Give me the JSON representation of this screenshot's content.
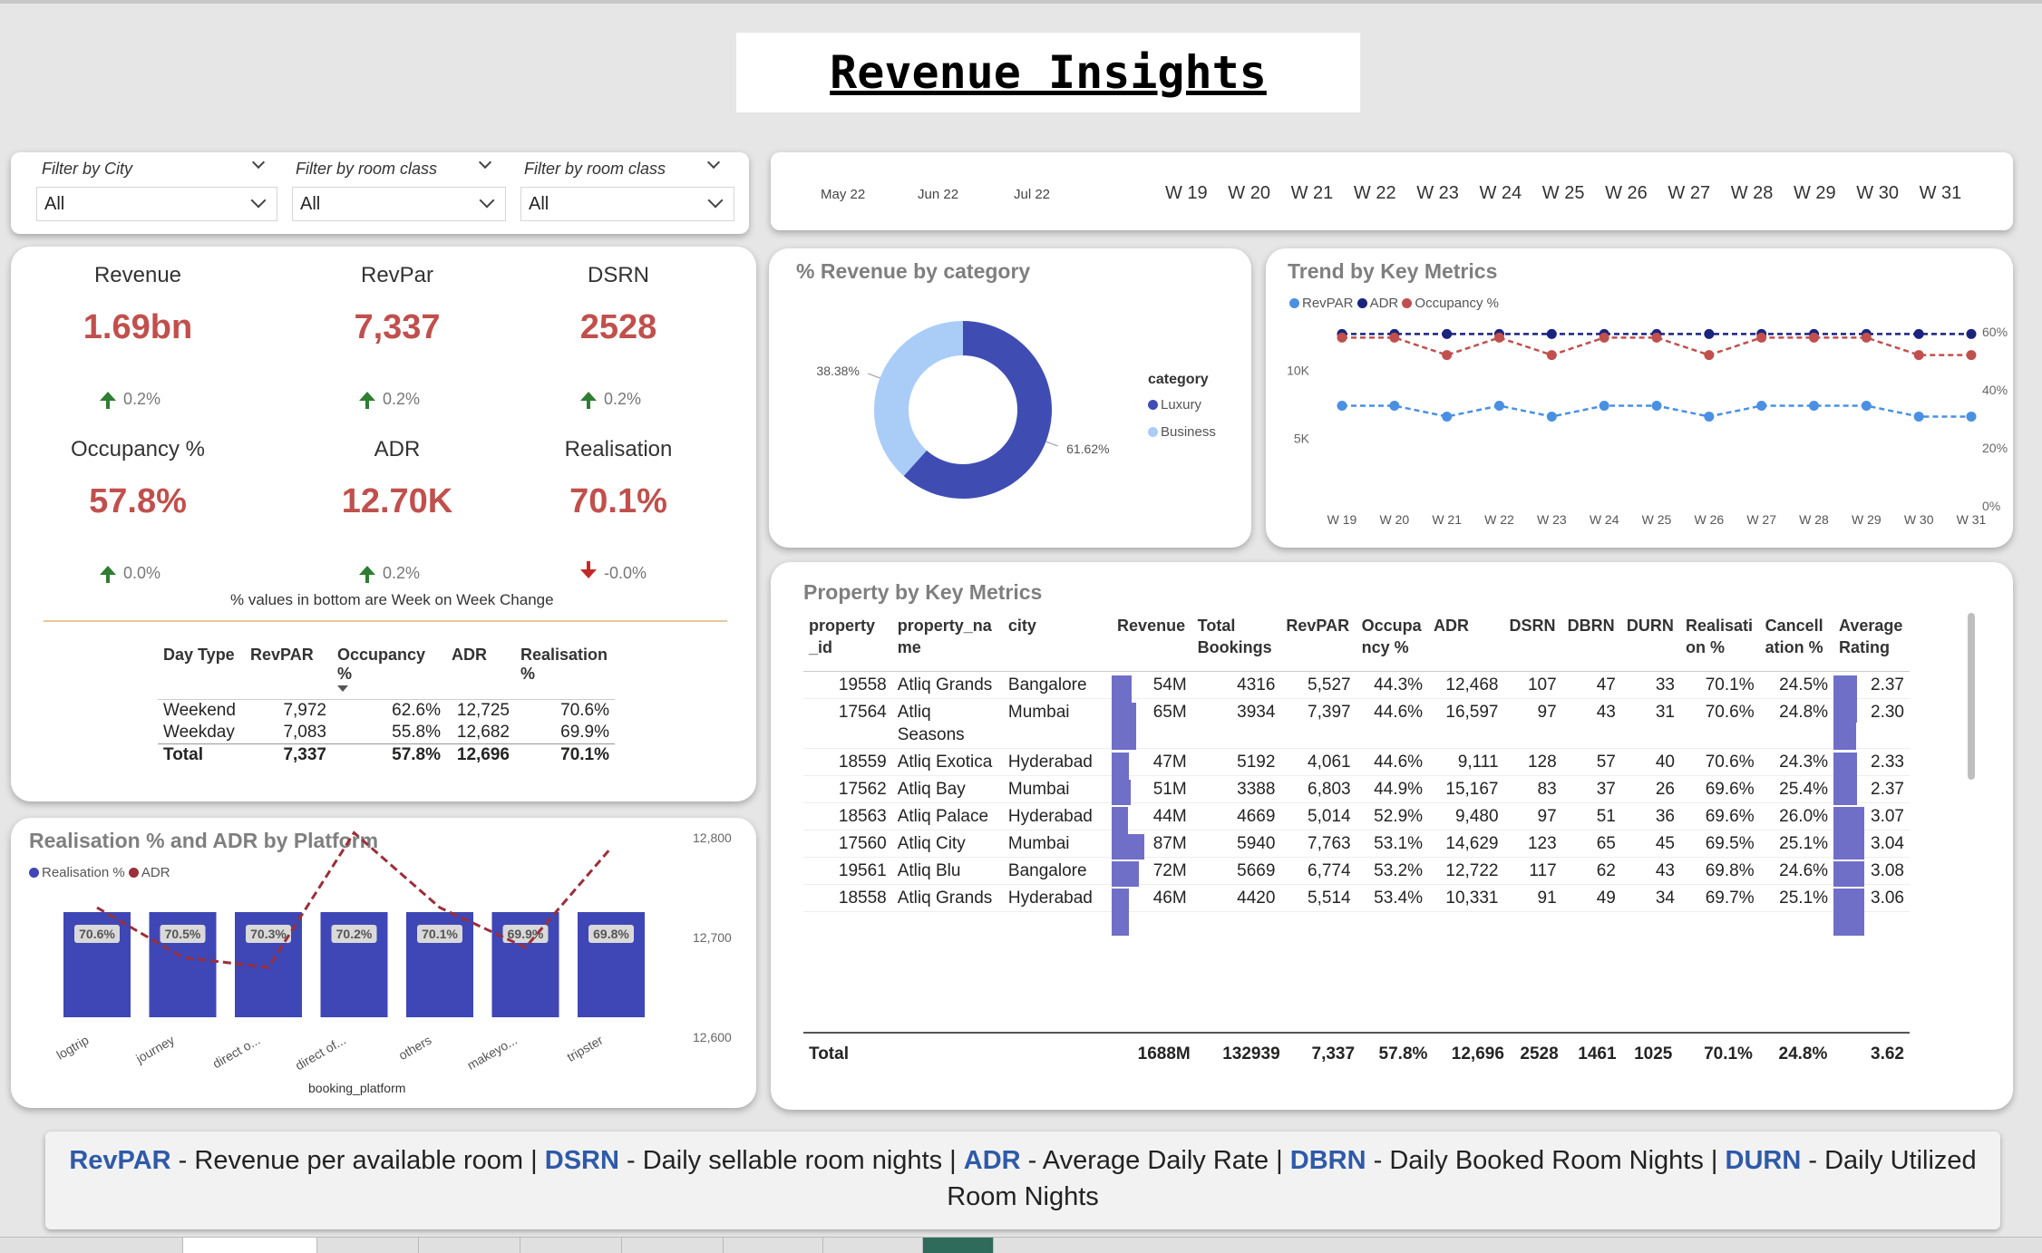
{
  "title": "Revenue Insights ",
  "filters": [
    {
      "label": "Filter by City",
      "value": "All"
    },
    {
      "label": "Filter by room class",
      "value": "All"
    },
    {
      "label": "Filter by room class",
      "value": "All"
    }
  ],
  "timeline": {
    "months": [
      "May 22",
      "Jun 22",
      "Jul 22"
    ],
    "weeks": [
      "W 19",
      "W 20",
      "W 21",
      "W 22",
      "W 23",
      "W 24",
      "W 25",
      "W 26",
      "W 27",
      "W 28",
      "W 29",
      "W 30",
      "W 31"
    ]
  },
  "kpis": [
    {
      "label": "Revenue",
      "value": "1.69bn",
      "change": "0.2%",
      "dir": "up"
    },
    {
      "label": "RevPar",
      "value": "7,337",
      "change": "0.2%",
      "dir": "up"
    },
    {
      "label": "DSRN",
      "value": "2528",
      "change": "0.2%",
      "dir": "up"
    },
    {
      "label": "Occupancy %",
      "value": "57.8%",
      "change": "0.0%",
      "dir": "up"
    },
    {
      "label": "ADR",
      "value": "12.70K",
      "change": "0.2%",
      "dir": "up"
    },
    {
      "label": "Realisation",
      "value": "70.1%",
      "change": "-0.0%",
      "dir": "down"
    }
  ],
  "kpi_note": "% values in bottom are Week on Week Change",
  "daytype_table": {
    "headers": [
      "Day Type",
      "RevPAR",
      "Occupancy %",
      "ADR",
      "Realisation %"
    ],
    "rows": [
      [
        "Weekend",
        "7,972",
        "62.6%",
        "12,725",
        "70.6%"
      ],
      [
        "Weekday",
        "7,083",
        "55.8%",
        "12,682",
        "69.9%"
      ]
    ],
    "total": [
      "Total",
      "7,337",
      "57.8%",
      "12,696",
      "70.1%"
    ]
  },
  "chart_data": [
    {
      "type": "pie",
      "title": "% Revenue by category",
      "legend_title": "category",
      "categories": [
        "Luxury",
        "Business"
      ],
      "values": [
        61.62,
        38.38
      ],
      "labels": [
        "61.62%",
        "38.38%"
      ],
      "colors": [
        "#3f4db3",
        "#a9cdf7"
      ]
    },
    {
      "type": "line",
      "title": "Trend by Key Metrics",
      "categories": [
        "W 19",
        "W 20",
        "W 21",
        "W 22",
        "W 23",
        "W 24",
        "W 25",
        "W 26",
        "W 27",
        "W 28",
        "W 29",
        "W 30",
        "W 31"
      ],
      "series": [
        {
          "name": "RevPAR",
          "axis": "left",
          "color": "#4a90e2",
          "values": [
            7400,
            7400,
            6600,
            7400,
            6600,
            7400,
            7400,
            6600,
            7400,
            7400,
            7400,
            6600,
            6600
          ]
        },
        {
          "name": "ADR",
          "axis": "left",
          "color": "#1a237e",
          "values": [
            12700,
            12700,
            12700,
            12700,
            12700,
            12700,
            12700,
            12700,
            12700,
            12700,
            12700,
            12700,
            12700
          ]
        },
        {
          "name": "Occupancy %",
          "axis": "right",
          "color": "#c0504d",
          "values": [
            58,
            58,
            52,
            58,
            52,
            58,
            58,
            52,
            58,
            58,
            58,
            52,
            52
          ]
        }
      ],
      "yticks_left": [
        "5K",
        "10K"
      ],
      "yticks_right": [
        "0%",
        "20%",
        "40%",
        "60%"
      ],
      "ylim_left": [
        0,
        15000
      ],
      "ylim_right": [
        0,
        70
      ]
    },
    {
      "type": "bar",
      "title": "Realisation % and ADR by Platform",
      "xlabel": "booking_platform",
      "categories": [
        "logtrip",
        "journey",
        "direct o...",
        "direct of...",
        "others",
        "makeyo...",
        "tripster"
      ],
      "series": [
        {
          "name": "Realisation %",
          "color": "#3f46b5",
          "values": [
            70.6,
            70.5,
            70.3,
            70.2,
            70.1,
            69.9,
            69.8
          ],
          "labels": [
            "70.6%",
            "70.5%",
            "70.3%",
            "70.2%",
            "70.1%",
            "69.9%",
            "69.8%"
          ]
        },
        {
          "name": "ADR",
          "color": "#9b2f3a",
          "values": [
            12730,
            12680,
            12670,
            12805,
            12730,
            12690,
            12790
          ]
        }
      ],
      "yticks_right": [
        "12,600",
        "12,700",
        "12,800"
      ],
      "ylim_right": [
        12560,
        12820
      ]
    }
  ],
  "property_table": {
    "title": "Property by Key Metrics",
    "headers": [
      "property_id",
      "property_name",
      "city",
      "Revenue",
      "Total Bookings",
      "RevPAR",
      "Occupancy %",
      "ADR",
      "DSRN",
      "DBRN",
      "DURN",
      "Realisation %",
      "Cancellation %",
      "Average Rating"
    ],
    "headers_display": [
      "property\n_id",
      "property_na\nme",
      "city",
      "Revenue",
      "Total\nBookings",
      "RevPAR",
      "Occupa\nncy %",
      "ADR",
      "DSRN",
      "DBRN",
      "DURN",
      "Realisati\non %",
      "Cancell\nation %",
      "Average\nRating"
    ],
    "rows": [
      {
        "id": "19558",
        "name": "Atliq Grands",
        "city": "Bangalore",
        "revenue": "54M",
        "rev_value": 54,
        "bookings": "4316",
        "revpar": "5,527",
        "occ": "44.3%",
        "adr": "12,468",
        "dsrn": "107",
        "dbrn": "47",
        "durn": "33",
        "real": "70.1%",
        "canc": "24.5%",
        "rating": "2.37",
        "rating_value": 2.37
      },
      {
        "id": "17564",
        "name": "Atliq Seasons",
        "city": "Mumbai",
        "revenue": "65M",
        "rev_value": 65,
        "bookings": "3934",
        "revpar": "7,397",
        "occ": "44.6%",
        "adr": "16,597",
        "dsrn": "97",
        "dbrn": "43",
        "durn": "31",
        "real": "70.6%",
        "canc": "24.8%",
        "rating": "2.30",
        "rating_value": 2.3
      },
      {
        "id": "18559",
        "name": "Atliq Exotica",
        "city": "Hyderabad",
        "revenue": "47M",
        "rev_value": 47,
        "bookings": "5192",
        "revpar": "4,061",
        "occ": "44.6%",
        "adr": "9,111",
        "dsrn": "128",
        "dbrn": "57",
        "durn": "40",
        "real": "70.6%",
        "canc": "24.3%",
        "rating": "2.33",
        "rating_value": 2.33
      },
      {
        "id": "17562",
        "name": "Atliq Bay",
        "city": "Mumbai",
        "revenue": "51M",
        "rev_value": 51,
        "bookings": "3388",
        "revpar": "6,803",
        "occ": "44.9%",
        "adr": "15,167",
        "dsrn": "83",
        "dbrn": "37",
        "durn": "26",
        "real": "69.6%",
        "canc": "25.4%",
        "rating": "2.37",
        "rating_value": 2.37
      },
      {
        "id": "18563",
        "name": "Atliq Palace",
        "city": "Hyderabad",
        "revenue": "44M",
        "rev_value": 44,
        "bookings": "4669",
        "revpar": "5,014",
        "occ": "52.9%",
        "adr": "9,480",
        "dsrn": "97",
        "dbrn": "51",
        "durn": "36",
        "real": "69.6%",
        "canc": "26.0%",
        "rating": "3.07",
        "rating_value": 3.07
      },
      {
        "id": "17560",
        "name": "Atliq City",
        "city": "Mumbai",
        "revenue": "87M",
        "rev_value": 87,
        "bookings": "5940",
        "revpar": "7,763",
        "occ": "53.1%",
        "adr": "14,629",
        "dsrn": "123",
        "dbrn": "65",
        "durn": "45",
        "real": "69.5%",
        "canc": "25.1%",
        "rating": "3.04",
        "rating_value": 3.04
      },
      {
        "id": "19561",
        "name": "Atliq Blu",
        "city": "Bangalore",
        "revenue": "72M",
        "rev_value": 72,
        "bookings": "5669",
        "revpar": "6,774",
        "occ": "53.2%",
        "adr": "12,722",
        "dsrn": "117",
        "dbrn": "62",
        "durn": "43",
        "real": "69.8%",
        "canc": "24.6%",
        "rating": "3.08",
        "rating_value": 3.08
      },
      {
        "id": "18558",
        "name": "Atliq Grands",
        "city": "Hyderabad",
        "revenue": "46M",
        "rev_value": 46,
        "bookings": "4420",
        "revpar": "5,514",
        "occ": "53.4%",
        "adr": "10,331",
        "dsrn": "91",
        "dbrn": "49",
        "durn": "34",
        "real": "69.7%",
        "canc": "25.1%",
        "rating": "3.06",
        "rating_value": 3.06
      }
    ],
    "total": {
      "label": "Total",
      "revenue": "1688M",
      "bookings": "132939",
      "revpar": "7,337",
      "occ": "57.8%",
      "adr": "12,696",
      "dsrn": "2528",
      "dbrn": "1461",
      "durn": "1025",
      "real": "70.1%",
      "canc": "24.8%",
      "rating": "3.62"
    }
  },
  "footer": {
    "parts": [
      {
        "term": "RevPAR",
        "desc": " - Revenue per available room | "
      },
      {
        "term": "DSRN",
        "desc": " - Daily sellable room nights | "
      },
      {
        "term": "ADR",
        "desc": " - Average Daily Rate | "
      },
      {
        "term": "DBRN",
        "desc": " - Daily Booked Room Nights | "
      },
      {
        "term": "DURN",
        "desc": " - Daily Utilized Room Nights"
      }
    ]
  }
}
